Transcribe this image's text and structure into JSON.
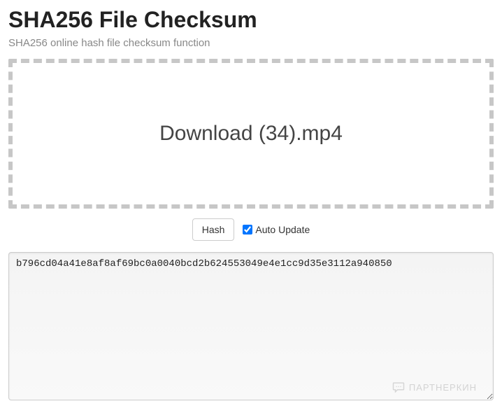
{
  "header": {
    "title": "SHA256 File Checksum",
    "subtitle": "SHA256 online hash file checksum function"
  },
  "dropzone": {
    "filename": "Download (34).mp4"
  },
  "controls": {
    "hash_button_label": "Hash",
    "auto_update_label": "Auto Update",
    "auto_update_checked": true
  },
  "output": {
    "hash_value": "b796cd04a41e8af8af69bc0a0040bcd2b624553049e4e1cc9d35e3112a940850"
  },
  "watermark": {
    "text": "ПАРТНЕРКИН"
  }
}
